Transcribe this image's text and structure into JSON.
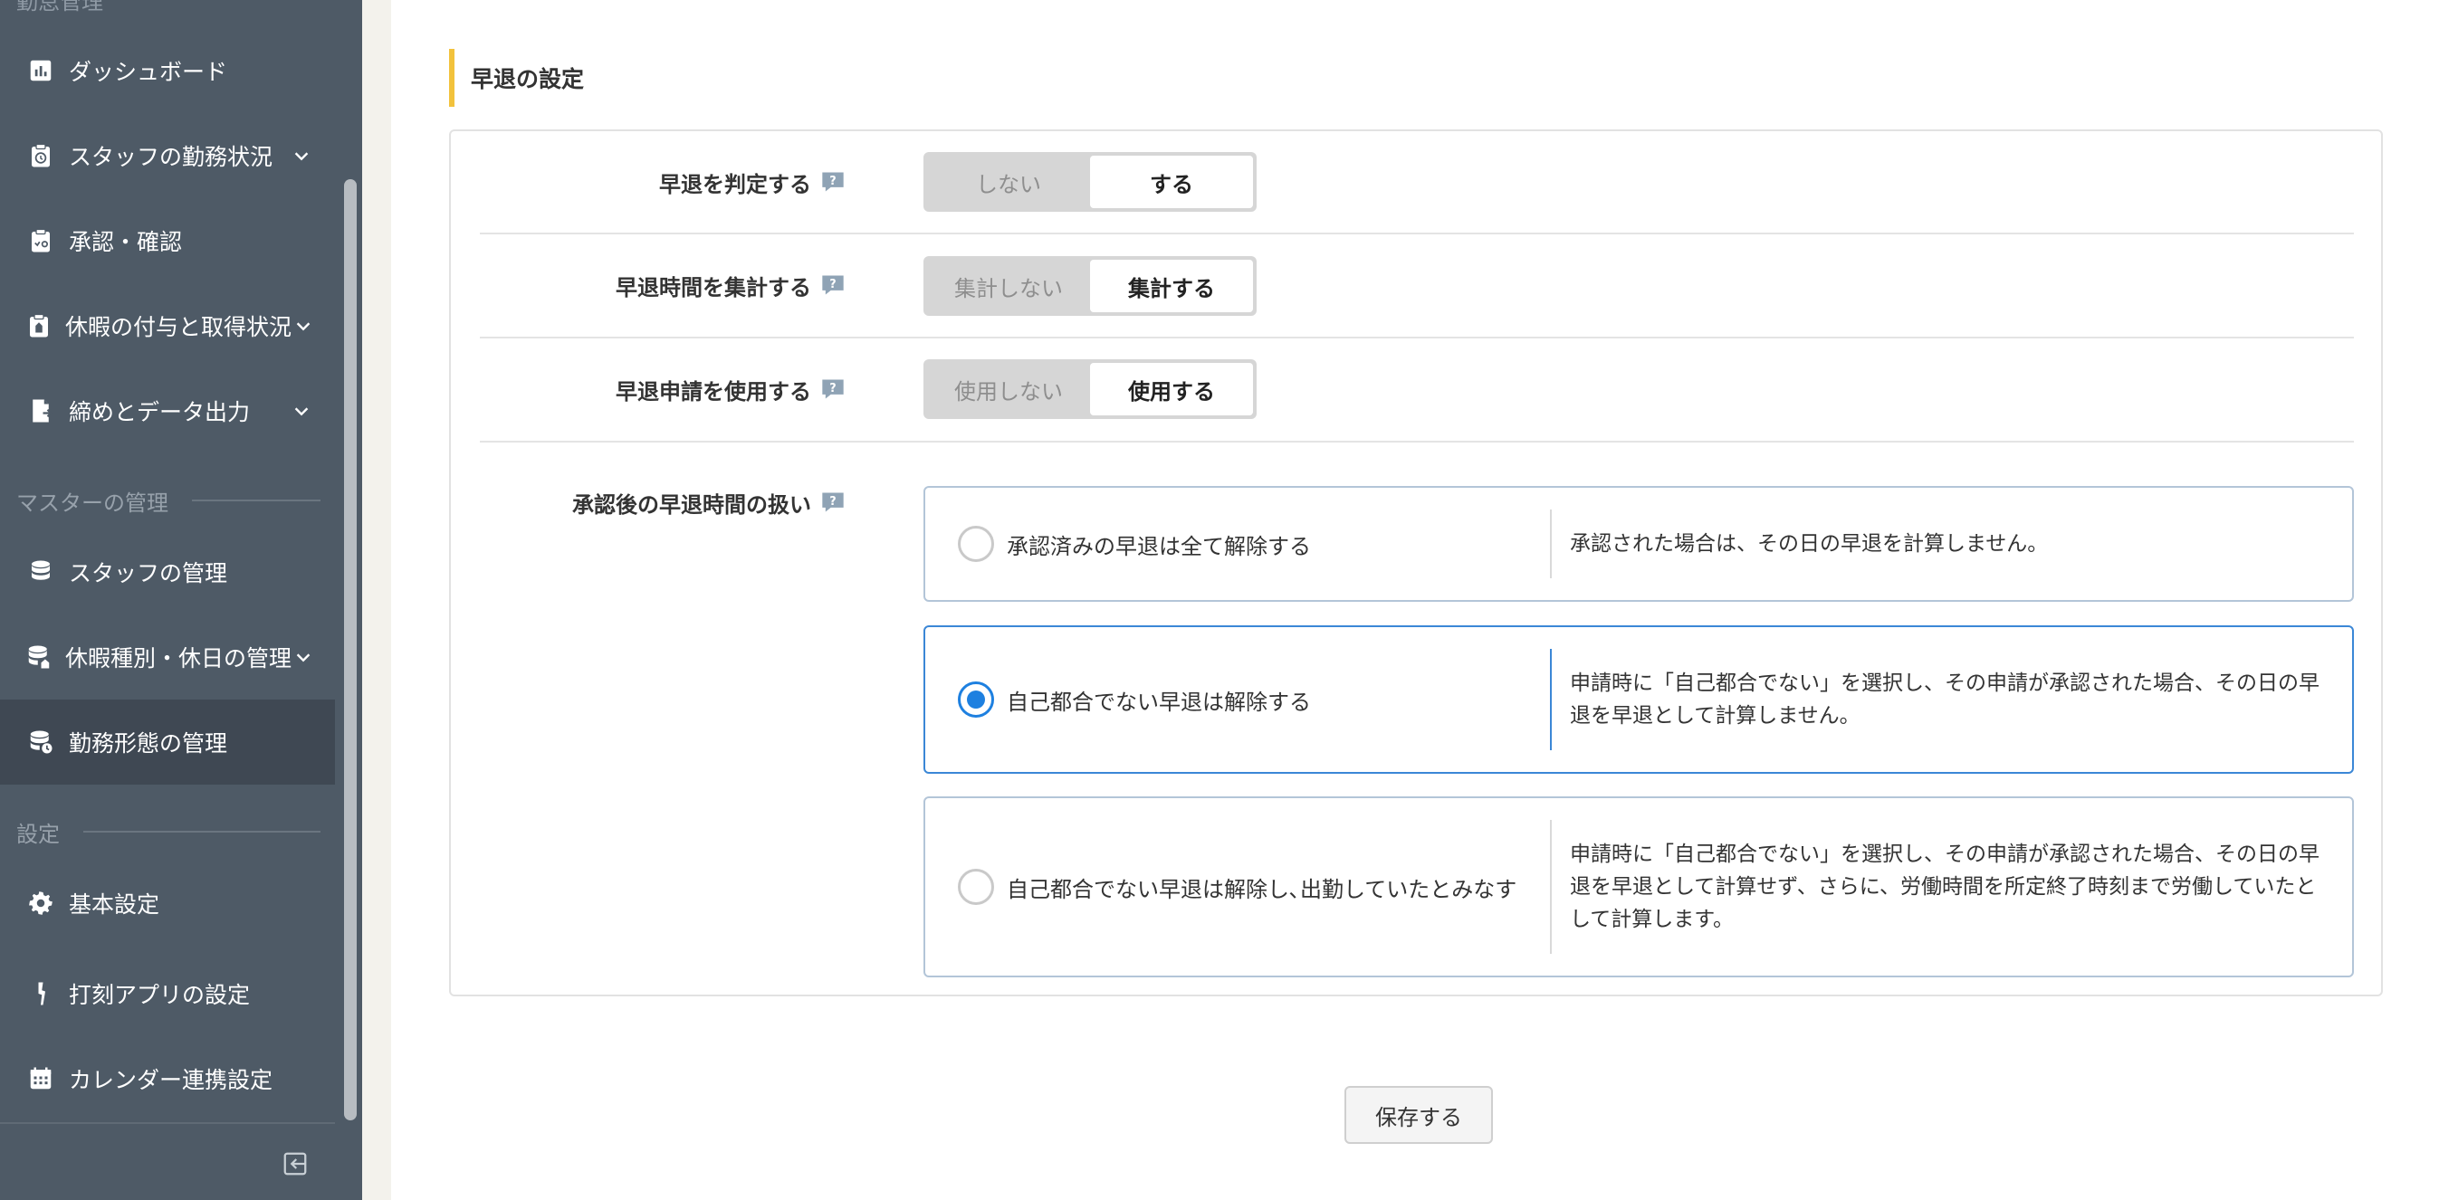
{
  "sidebar": {
    "top_heading": "勤怠管理",
    "items": [
      {
        "label": "ダッシュボード",
        "icon": "chart-bar-icon",
        "has_chevron": false
      },
      {
        "label": "スタッフの勤務状況",
        "icon": "clock-board-icon",
        "has_chevron": true
      },
      {
        "label": "承認・確認",
        "icon": "clipboard-check-icon",
        "has_chevron": false
      },
      {
        "label": "休暇の付与と取得状況",
        "icon": "clipboard-leave-icon",
        "has_chevron": true
      },
      {
        "label": "締めとデータ出力",
        "icon": "file-export-icon",
        "has_chevron": true
      }
    ],
    "section_master": "マスターの管理",
    "master_items": [
      {
        "label": "スタッフの管理",
        "icon": "database-icon",
        "has_chevron": false
      },
      {
        "label": "休暇種別・休日の管理",
        "icon": "database-leave-icon",
        "has_chevron": true
      },
      {
        "label": "勤務形態の管理",
        "icon": "database-clock-icon",
        "has_chevron": false,
        "active": true
      }
    ],
    "section_settings": "設定",
    "settings_items": [
      {
        "label": "基本設定",
        "icon": "gear-icon",
        "has_chevron": false
      },
      {
        "label": "打刻アプリの設定",
        "icon": "punch-app-icon",
        "has_chevron": false
      },
      {
        "label": "カレンダー連携設定",
        "icon": "calendar-icon",
        "has_chevron": false
      }
    ]
  },
  "main": {
    "section_title": "早退の設定",
    "rows": [
      {
        "label": "早退を判定する",
        "options": [
          "しない",
          "する"
        ],
        "selected": 1
      },
      {
        "label": "早退時間を集計する",
        "options": [
          "集計しない",
          "集計する"
        ],
        "selected": 1
      },
      {
        "label": "早退申請を使用する",
        "options": [
          "使用しない",
          "使用する"
        ],
        "selected": 1
      }
    ],
    "approval": {
      "label": "承認後の早退時間の扱い",
      "options": [
        {
          "label": "承認済みの早退は全て解除する",
          "desc": "承認された場合は、その日の早退を計算しません。",
          "checked": false
        },
        {
          "label": "自己都合でない早退は解除する",
          "desc": "申請時に「自己都合でない」を選択し、その申請が承認された場合、その日の早退を早退として計算しません。",
          "checked": true
        },
        {
          "label": "自己都合でない早退は解除し､出勤していたとみなす",
          "desc": "申請時に「自己都合でない」を選択し、その申請が承認された場合、その日の早退を早退として計算せず、さらに、労働時間を所定終了時刻まで労働していたとして計算します。",
          "checked": false
        }
      ]
    },
    "save_label": "保存する"
  },
  "colors": {
    "sidebar_bg": "#4e5a66",
    "sidebar_active": "#3f4853",
    "accent_bar": "#f2c23c",
    "radio_selected": "#1e80e0",
    "help_icon": "#8fa3b5"
  }
}
